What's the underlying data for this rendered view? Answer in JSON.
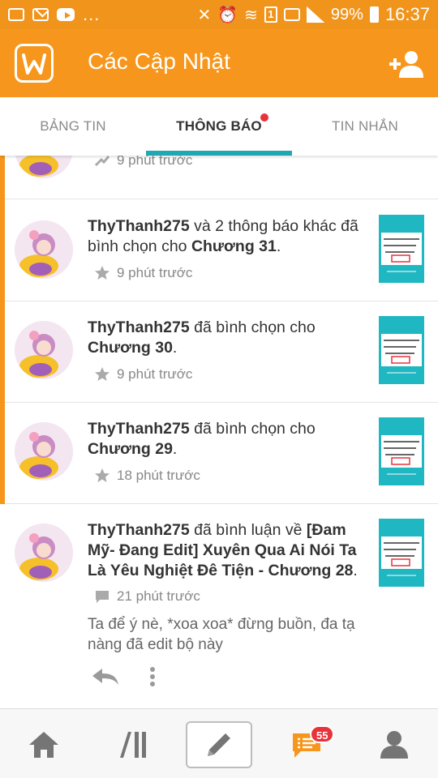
{
  "status_bar": {
    "battery": "99%",
    "time": "16:37",
    "dots": "...",
    "sim": "1"
  },
  "header": {
    "title": "Các Cập Nhật"
  },
  "tabs": [
    {
      "label": "BẢNG TIN",
      "active": false
    },
    {
      "label": "THÔNG BÁO",
      "active": true,
      "has_dot": true
    },
    {
      "label": "TIN NHẮN",
      "active": false
    }
  ],
  "notifications": [
    {
      "user": "",
      "text": "",
      "time": "9 phút trước",
      "icon": "vote-icon"
    },
    {
      "user": "ThyThanh275",
      "text": " và 2 thông báo khác đã bình chọn cho ",
      "target": "Chương 31",
      "end": ".",
      "time": "9 phút trước",
      "icon": "star-icon"
    },
    {
      "user": "ThyThanh275",
      "text": " đã bình chọn cho ",
      "target": "Chương 30",
      "end": ".",
      "time": "9 phút trước",
      "icon": "star-icon"
    },
    {
      "user": "ThyThanh275",
      "text": " đã bình chọn cho ",
      "target": "Chương 29",
      "end": ".",
      "time": "18 phút trước",
      "icon": "star-icon"
    },
    {
      "user": "ThyThanh275",
      "text": " đã bình luận về ",
      "target": "[Đam Mỹ- Đang Edit] Xuyên Qua Ai Nói Ta Là Yêu Nghiệt Đê Tiện - Chương 28",
      "end": ".",
      "time": "21 phút trước",
      "icon": "comment-icon",
      "comment": "Ta để ý nè, *xoa xoa* đừng buồn, đa tạ nàng đã edit bộ này"
    }
  ],
  "bottom_nav": {
    "message_badge": "55"
  },
  "colors": {
    "brand": "#f7961c",
    "tab_accent": "#1fa8b1",
    "badge": "#e8333b"
  }
}
